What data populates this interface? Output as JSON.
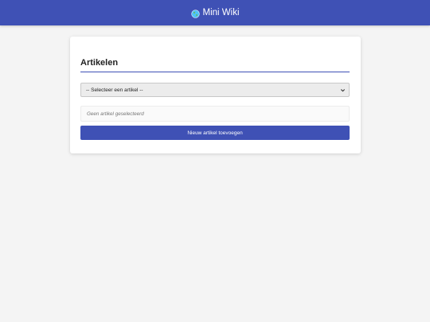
{
  "header": {
    "title": "Mini Wiki",
    "icon": "globe-icon",
    "background_color": "#3f51b5"
  },
  "card": {
    "title": "Artikelen",
    "select": {
      "selected": "-- Selecteer een artikel --"
    },
    "display_text": "Geen artikel geselecteerd",
    "add_button_label": "Nieuw artikel toevoegen"
  }
}
